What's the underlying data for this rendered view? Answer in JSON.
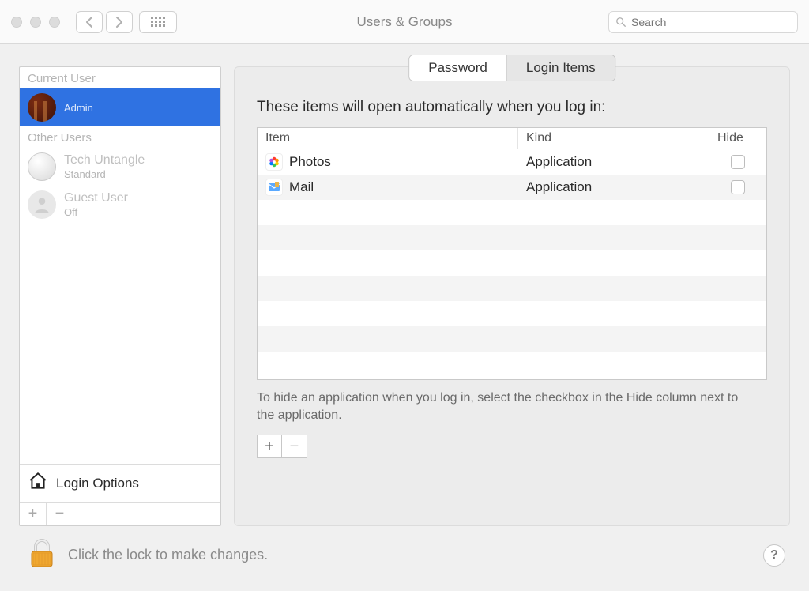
{
  "window": {
    "title": "Users & Groups",
    "search_placeholder": "Search"
  },
  "sidebar": {
    "current_user_label": "Current User",
    "other_users_label": "Other Users",
    "current_user": {
      "name": "",
      "role": "Admin"
    },
    "other_users": [
      {
        "name": "Tech Untangle",
        "role": "Standard"
      },
      {
        "name": "Guest User",
        "role": "Off"
      }
    ],
    "login_options_label": "Login Options"
  },
  "tabs": {
    "password": "Password",
    "login_items": "Login Items"
  },
  "panel": {
    "heading": "These items will open automatically when you log in:",
    "columns": {
      "item": "Item",
      "kind": "Kind",
      "hide": "Hide"
    },
    "items": [
      {
        "name": "Photos",
        "kind": "Application",
        "hide": false,
        "icon": "photos"
      },
      {
        "name": "Mail",
        "kind": "Application",
        "hide": false,
        "icon": "mail"
      }
    ],
    "hint": "To hide an application when you log in, select the checkbox in the Hide column next to the application."
  },
  "footer": {
    "lock_text": "Click the lock to make changes.",
    "help": "?"
  }
}
